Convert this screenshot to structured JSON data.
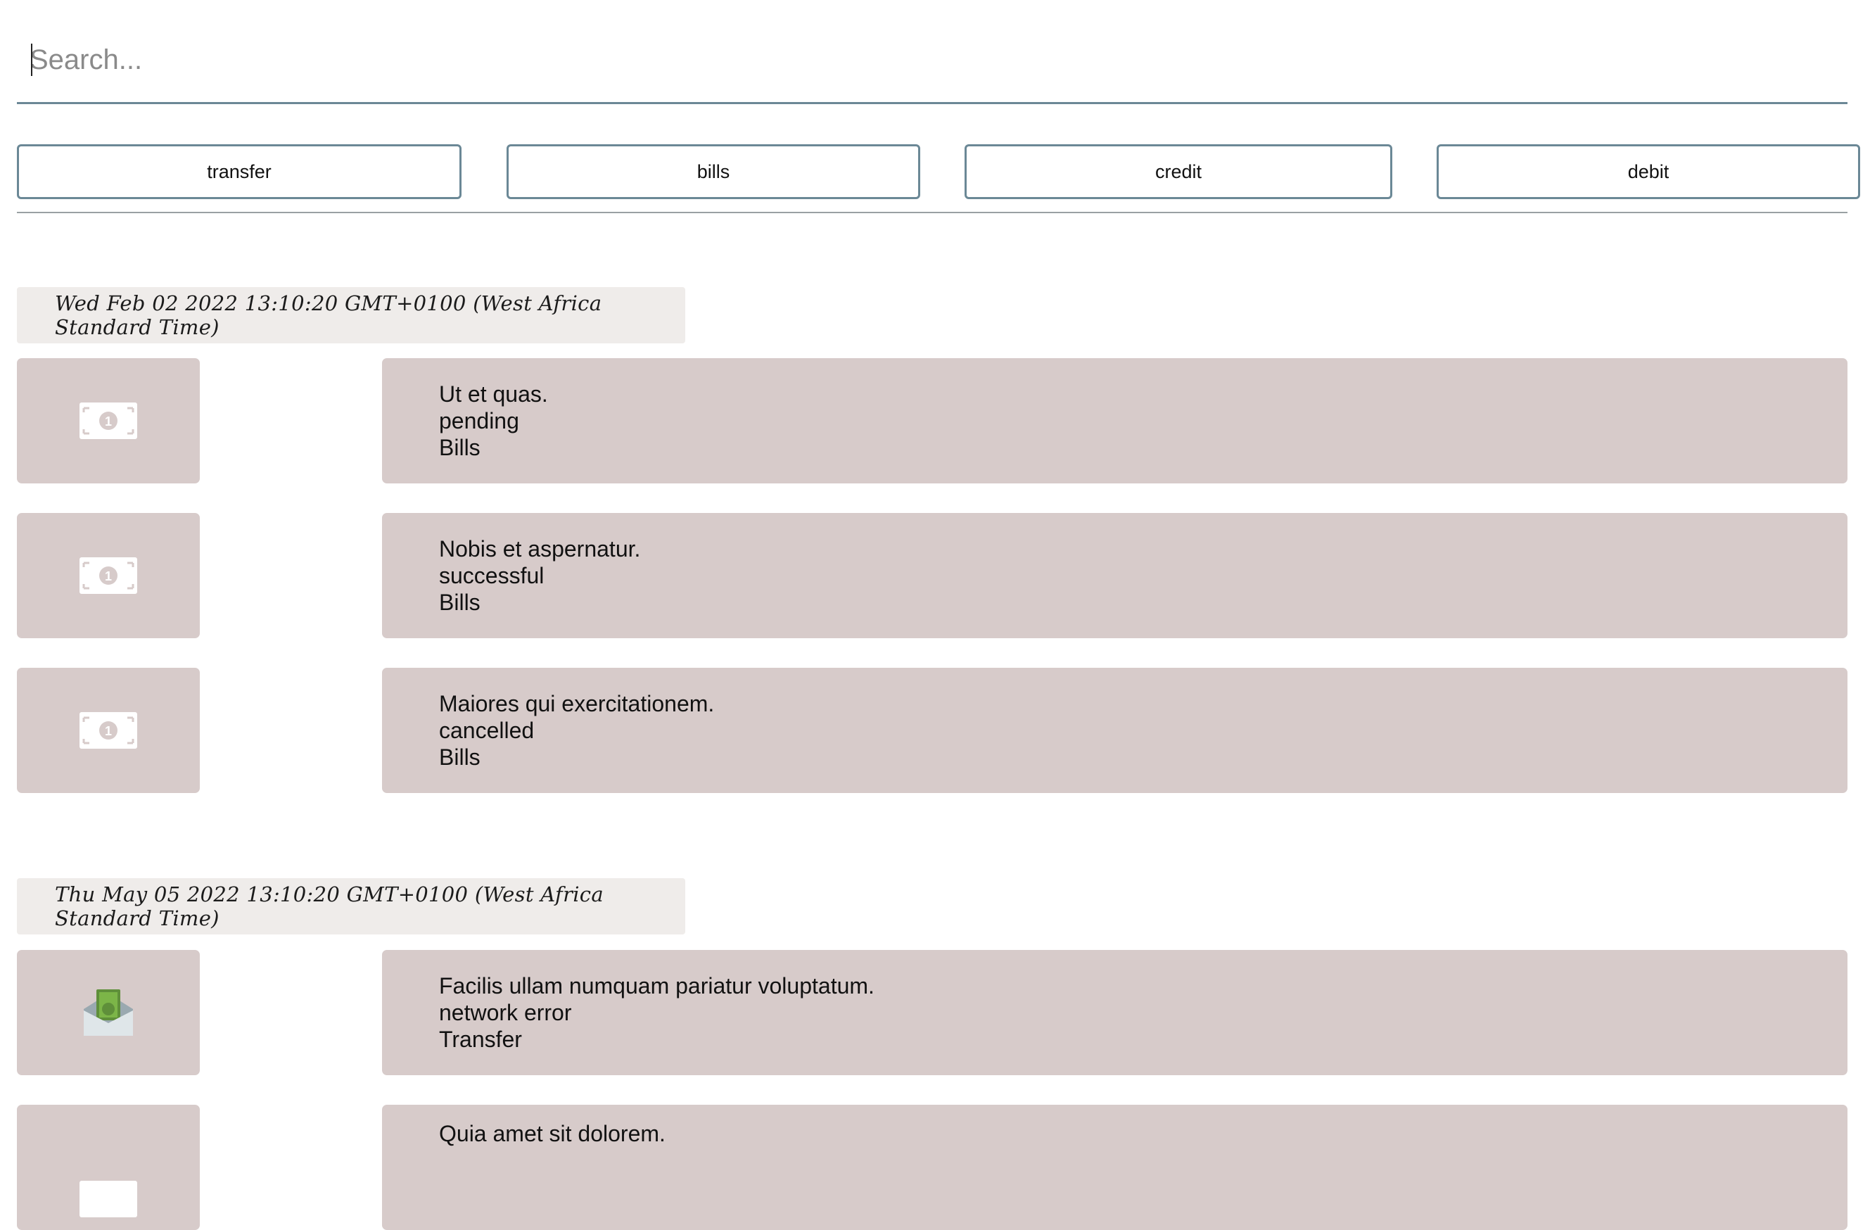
{
  "search": {
    "placeholder": "Search..."
  },
  "filters": [
    {
      "label": "transfer"
    },
    {
      "label": "bills"
    },
    {
      "label": "credit"
    },
    {
      "label": "debit"
    }
  ],
  "groups": [
    {
      "date": "Wed Feb 02 2022 13:10:20 GMT+0100 (West Africa Standard Time)",
      "transactions": [
        {
          "icon": "money-bill-icon",
          "title": "Ut et quas.",
          "status": "pending",
          "category": "Bills"
        },
        {
          "icon": "money-bill-icon",
          "title": "Nobis et aspernatur.",
          "status": "successful",
          "category": "Bills"
        },
        {
          "icon": "money-bill-icon",
          "title": "Maiores qui exercitationem.",
          "status": "cancelled",
          "category": "Bills"
        }
      ]
    },
    {
      "date": "Thu May 05 2022 13:10:20 GMT+0100 (West Africa Standard Time)",
      "transactions": [
        {
          "icon": "money-envelope-icon",
          "title": "Facilis ullam numquam pariatur voluptatum.",
          "status": "network error",
          "category": "Transfer"
        },
        {
          "icon": "money-bill-icon",
          "title": "Quia amet sit dolorem."
        }
      ]
    }
  ],
  "colors": {
    "accent": "#6b8896",
    "card_bg": "#d7cbca",
    "date_bg": "#efecea"
  }
}
